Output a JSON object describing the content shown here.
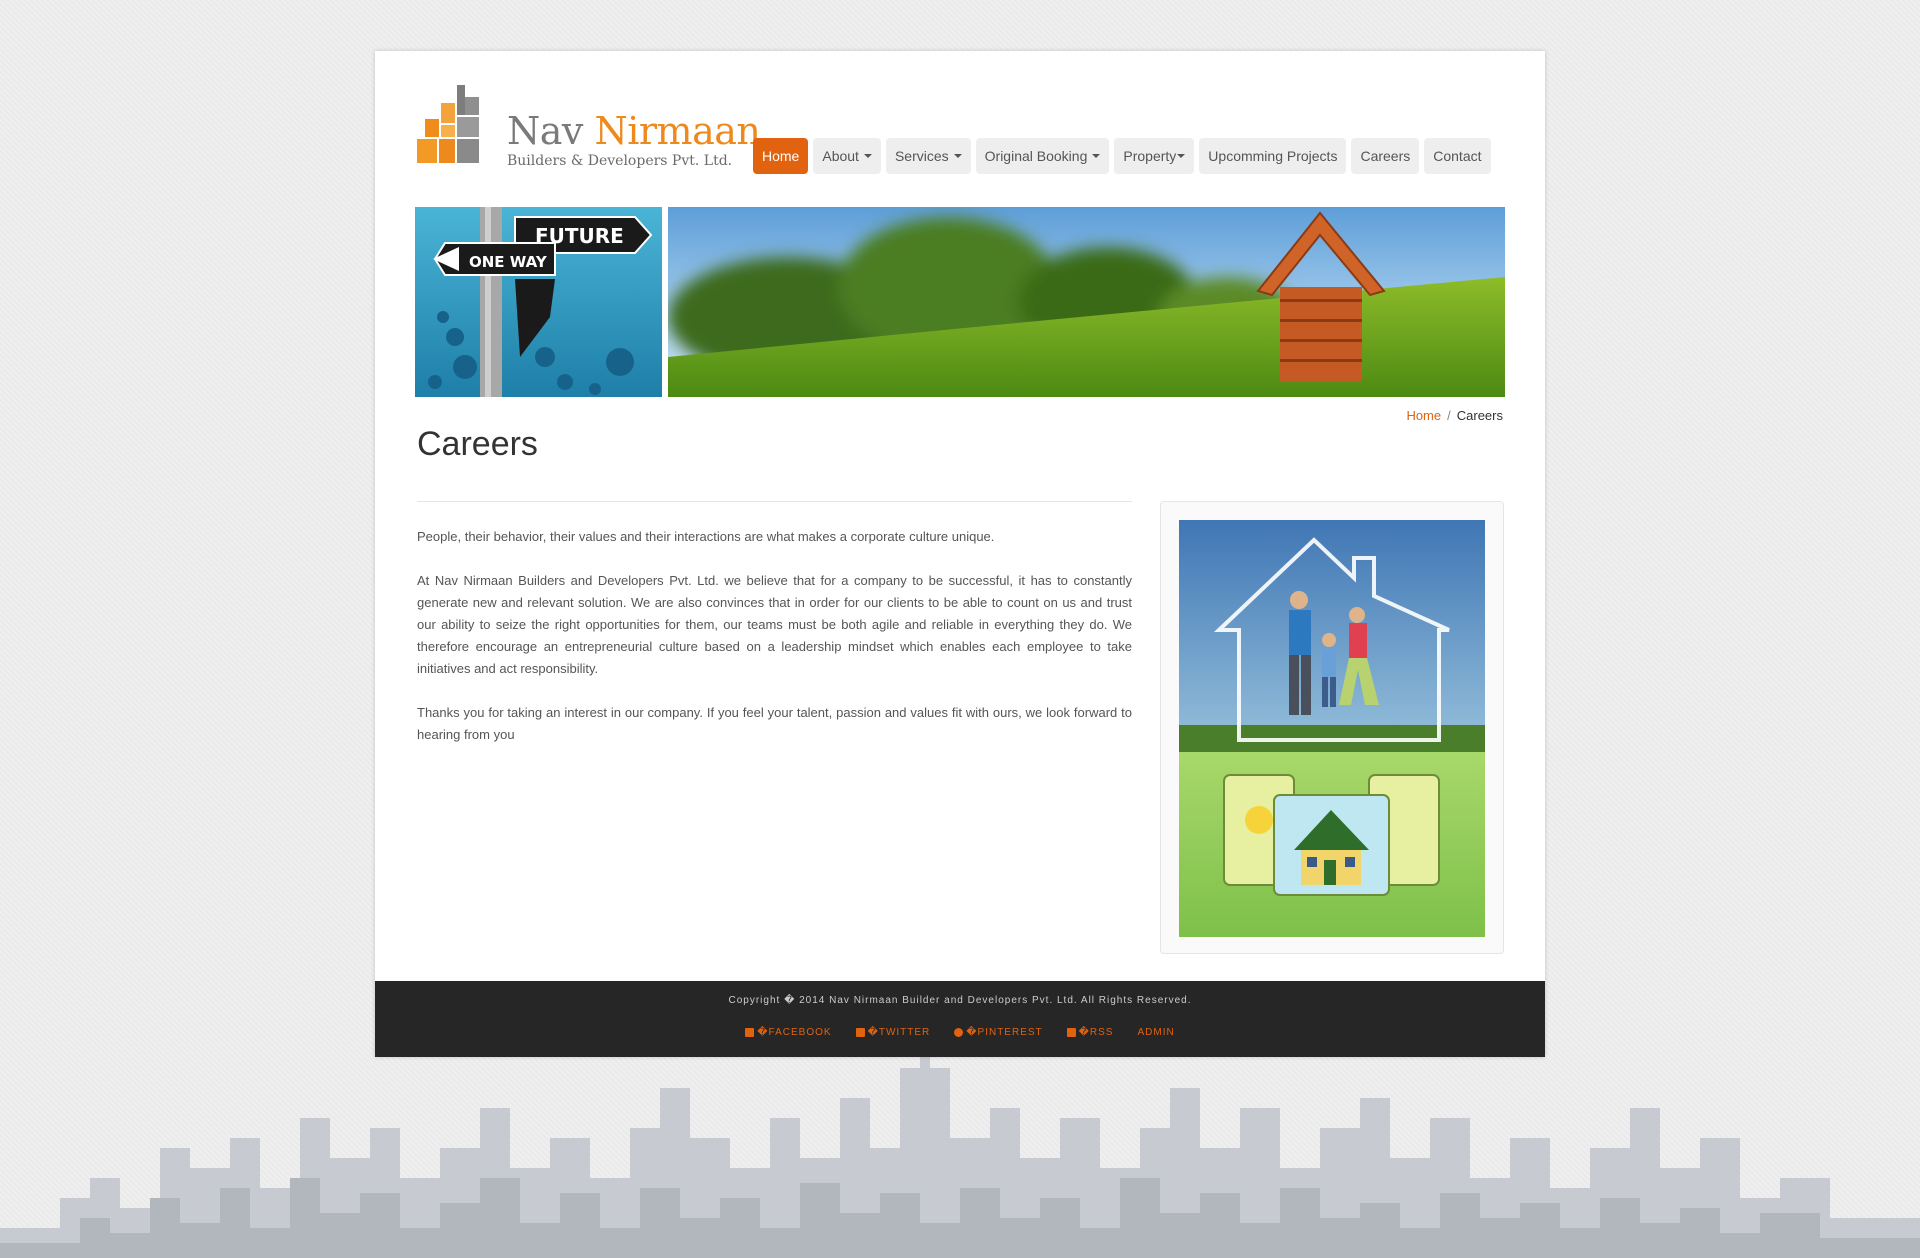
{
  "brand": {
    "name_primary": "Nav",
    "name_accent": "Nirmaan",
    "tagline": "Builders & Developers Pvt. Ltd."
  },
  "nav": {
    "items": [
      {
        "label": "Home",
        "active": true,
        "dropdown": false
      },
      {
        "label": "About",
        "active": false,
        "dropdown": true
      },
      {
        "label": "Services",
        "active": false,
        "dropdown": true
      },
      {
        "label": "Original Booking",
        "active": false,
        "dropdown": true
      },
      {
        "label": "Property",
        "active": false,
        "dropdown": true
      },
      {
        "label": "Upcomming Projects",
        "active": false,
        "dropdown": false
      },
      {
        "label": "Careers",
        "active": false,
        "dropdown": false
      },
      {
        "label": "Contact",
        "active": false,
        "dropdown": false
      }
    ]
  },
  "banner": {
    "sign_top": "FUTURE",
    "sign_middle": "ONE WAY"
  },
  "breadcrumb": {
    "home": "Home",
    "separator": "/",
    "current": "Careers"
  },
  "page": {
    "title": "Careers",
    "paragraphs": [
      "People, their behavior, their values and their interactions are what makes a corporate culture unique.",
      "At Nav Nirmaan Builders and Developers Pvt. Ltd. we believe that for a company to be successful, it has to constantly generate new and relevant solution. We are also convinces that in order for our clients to be able to count on us and trust our ability to seize the right opportunities for them, our teams must be both agile and reliable in everything they do. We therefore encourage an entrepreneurial culture based on a leadership mindset which enables each employee to take initiatives and act responsibility.",
      "Thanks you for taking an interest in our company. If you feel your talent, passion and values fit with ours, we look forward to hearing from you"
    ]
  },
  "footer": {
    "copyright": "Copyright � 2014 Nav Nirmaan Builder and Developers Pvt. Ltd. All Rights Reserved.",
    "links": [
      {
        "label": "�FACEBOOK",
        "icon": "facebook-icon"
      },
      {
        "label": "�TWITTER",
        "icon": "twitter-icon"
      },
      {
        "label": "�PINTEREST",
        "icon": "pinterest-icon"
      },
      {
        "label": "�RSS",
        "icon": "rss-icon"
      },
      {
        "label": "ADMIN",
        "icon": ""
      }
    ]
  },
  "colors": {
    "accent": "#e1620f",
    "logo_orange": "#ee8a1d",
    "footer_bg": "#262626"
  }
}
